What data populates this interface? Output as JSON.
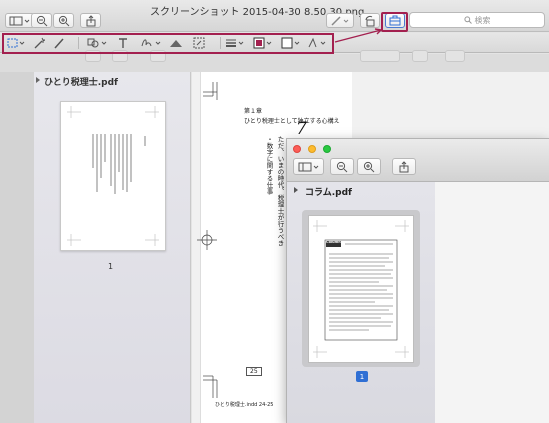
{
  "window": {
    "title": "スクリーンショット 2015-04-30 8.50.30.png",
    "search_placeholder": "検索"
  },
  "sidebar": {
    "doc_title": "ひとり税理士.pdf",
    "page_number": "1"
  },
  "page": {
    "chapter": "第１章",
    "subtitle": "ひとり税理士として独立する心構え",
    "body_lines": [
      "私の場合は、大手監査法人を出たあと、",
      "ででなったら、後継者がいなくて、事務所の",
      "知り合いの税理士事務所に勤め、実務経験",
      "ただ、いまの時代、税理士が行うべき",
      "・数字に関する仕事"
    ],
    "page_num": "25",
    "footer": "ひとり税理士.indd  24-25"
  },
  "annotation": {
    "handwritten": "7"
  },
  "window2": {
    "doc_title": "コラム.pdf",
    "page_badge": "1",
    "column_header": "Column ①"
  },
  "colors": {
    "highlight": "#a3204f",
    "selection_blue": "#2f6fd4"
  }
}
